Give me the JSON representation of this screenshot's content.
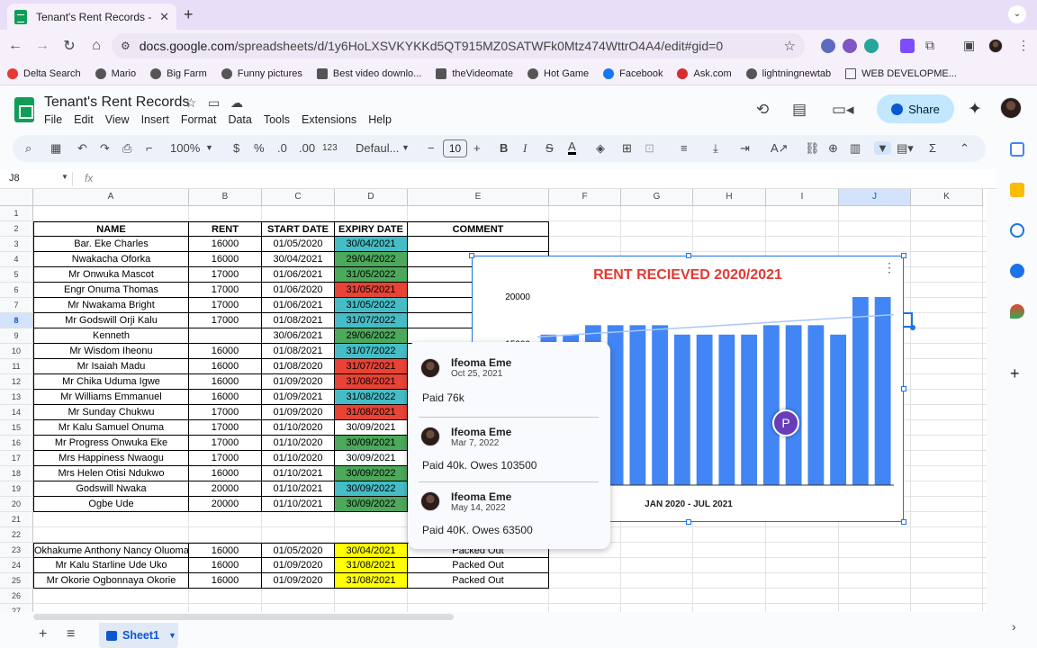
{
  "browser": {
    "tab_title": "Tenant's Rent Records - Goo",
    "url_prefix": "docs.google.com",
    "url_path": "/spreadsheets/d/1y6HoLXSVKYKKd5QT915MZ0SATWFk0Mtz474WttrO4A4/edit#gid=0",
    "bookmarks": [
      "Delta Search",
      "Mario",
      "Big Farm",
      "Funny pictures",
      "Best video downlo...",
      "theVideomate",
      "Hot Game",
      "Facebook",
      "Ask.com",
      "lightningnewtab",
      "WEB DEVELOPME..."
    ]
  },
  "doc": {
    "title": "Tenant's Rent Records",
    "menus": [
      "File",
      "Edit",
      "View",
      "Insert",
      "Format",
      "Data",
      "Tools",
      "Extensions",
      "Help"
    ],
    "share_label": "Share"
  },
  "toolbar": {
    "zoom": "100%",
    "currency": "$",
    "percent": "%",
    "dec_minus": ".0",
    "dec_plus": ".00",
    "number_format": "123",
    "font": "Defaul...",
    "font_size": "10",
    "bold": "B",
    "italic": "I",
    "strike": "S",
    "text_color": "A"
  },
  "formula_bar": {
    "cell_ref": "J8",
    "fx": "fx"
  },
  "sheet": {
    "columns": [
      "A",
      "B",
      "C",
      "D",
      "E",
      "F",
      "G",
      "H",
      "I",
      "J",
      "K"
    ],
    "selected_column": "J",
    "selected_row": 8,
    "row_numbers": [
      "1",
      "2",
      "3",
      "4",
      "5",
      "6",
      "7",
      "8",
      "9",
      "10",
      "11",
      "12",
      "13",
      "14",
      "15",
      "16",
      "17",
      "18",
      "19",
      "20",
      "21",
      "22",
      "23",
      "24",
      "25",
      "26",
      "27"
    ],
    "headers": [
      "NAME",
      "RENT",
      "START DATE",
      "EXPIRY DATE",
      "COMMENT"
    ],
    "rows": [
      {
        "name": "Bar. Eke Charles",
        "rent": "16000",
        "start": "01/05/2020",
        "expiry": "30/04/2021",
        "color": "#46bdc6",
        "comment": ""
      },
      {
        "name": "Nwakacha Oforka",
        "rent": "16000",
        "start": "30/04/2021",
        "expiry": "29/04/2022",
        "color": "#4ca85a",
        "comment": ""
      },
      {
        "name": "Mr Onwuka Mascot",
        "rent": "17000",
        "start": "01/06/2021",
        "expiry": "31/05/2022",
        "color": "#4ca85a",
        "comment": ""
      },
      {
        "name": "Engr Onuma Thomas",
        "rent": "17000",
        "start": "01/06/2020",
        "expiry": "31/05/2021",
        "color": "#e84335",
        "comment": ""
      },
      {
        "name": "Mr Nwakama Bright",
        "rent": "17000",
        "start": "01/06/2021",
        "expiry": "31/05/2022",
        "color": "#46bdc6",
        "comment": ""
      },
      {
        "name": "Mr Godswill Orji Kalu",
        "rent": "17000",
        "start": "01/08/2021",
        "expiry": "31/07/2022",
        "color": "#46bdc6",
        "comment": ""
      },
      {
        "name": "Kenneth",
        "rent": "",
        "start": "30/06/2021",
        "expiry": "29/06/2022",
        "color": "#4ca85a",
        "comment": ""
      },
      {
        "name": "Mr Wisdom Iheonu",
        "rent": "16000",
        "start": "01/08/2021",
        "expiry": "31/07/2022",
        "color": "#46bdc6",
        "comment": ""
      },
      {
        "name": "Mr Isaiah Madu",
        "rent": "16000",
        "start": "01/08/2020",
        "expiry": "31/07/2021",
        "color": "#e84335",
        "comment": ""
      },
      {
        "name": "Mr Chika Uduma Igwe",
        "rent": "16000",
        "start": "01/09/2020",
        "expiry": "31/08/2021",
        "color": "#e84335",
        "comment": ""
      },
      {
        "name": "Mr Williams Emmanuel",
        "rent": "16000",
        "start": "01/09/2021",
        "expiry": "31/08/2022",
        "color": "#46bdc6",
        "comment": ""
      },
      {
        "name": "Mr Sunday Chukwu",
        "rent": "17000",
        "start": "01/09/2020",
        "expiry": "31/08/2021",
        "color": "#e84335",
        "comment": ""
      },
      {
        "name": "Mr Kalu Samuel Onuma",
        "rent": "17000",
        "start": "01/10/2020",
        "expiry": "30/09/2021",
        "color": "",
        "comment": ""
      },
      {
        "name": "Mr Progress Onwuka Eke",
        "rent": "17000",
        "start": "01/10/2020",
        "expiry": "30/09/2021",
        "color": "#4ca85a",
        "comment": ""
      },
      {
        "name": "Mrs Happiness Nwaogu",
        "rent": "17000",
        "start": "01/10/2020",
        "expiry": "30/09/2021",
        "color": "",
        "comment": ""
      },
      {
        "name": "Mrs Helen Otisi Ndukwo",
        "rent": "16000",
        "start": "01/10/2021",
        "expiry": "30/09/2022",
        "color": "#4ca85a",
        "comment": ""
      },
      {
        "name": "Godswill Nwaka",
        "rent": "20000",
        "start": "01/10/2021",
        "expiry": "30/09/2022",
        "color": "#46bdc6",
        "comment": ""
      },
      {
        "name": "Ogbe Ude",
        "rent": "20000",
        "start": "01/10/2021",
        "expiry": "30/09/2022",
        "color": "#4ca85a",
        "comment": ""
      }
    ],
    "rows_lower": [
      {
        "name": "Okhakume Anthony Nancy Oluoma",
        "rent": "16000",
        "start": "01/05/2020",
        "expiry": "30/04/2021",
        "color": "#ffff00",
        "comment": "Packed Out"
      },
      {
        "name": "Mr Kalu Starline Ude Uko",
        "rent": "16000",
        "start": "01/09/2020",
        "expiry": "31/08/2021",
        "color": "#ffff00",
        "comment": "Packed Out"
      },
      {
        "name": "Mr Okorie Ogbonnaya Okorie",
        "rent": "16000",
        "start": "01/09/2020",
        "expiry": "31/08/2021",
        "color": "#ffff00",
        "comment": "Packed Out"
      }
    ]
  },
  "chart_data": {
    "type": "bar",
    "title": "RENT RECIEVED 2020/2021",
    "xlabel": "JAN  2020 - JUL 2021",
    "ylabel": "",
    "yticks": [
      "20000",
      "15000"
    ],
    "ylim": [
      0,
      20000
    ],
    "bar_color": "#4285f4",
    "title_color": "#e53935",
    "values": [
      16000,
      16000,
      17000,
      17000,
      17000,
      17000,
      16000,
      16000,
      16000,
      16000,
      17000,
      17000,
      17000,
      16000,
      20000,
      20000
    ],
    "trendline": true
  },
  "comments": [
    {
      "author": "Ifeoma Eme",
      "date": "Oct 25, 2021",
      "text": "Paid 76k"
    },
    {
      "author": "Ifeoma Eme",
      "date": "Mar 7, 2022",
      "text": "Paid 40k. Owes 103500"
    },
    {
      "author": "Ifeoma Eme",
      "date": "May 14, 2022",
      "text": "Paid 40K. Owes 63500"
    }
  ],
  "bottom": {
    "sheet_name": "Sheet1"
  }
}
